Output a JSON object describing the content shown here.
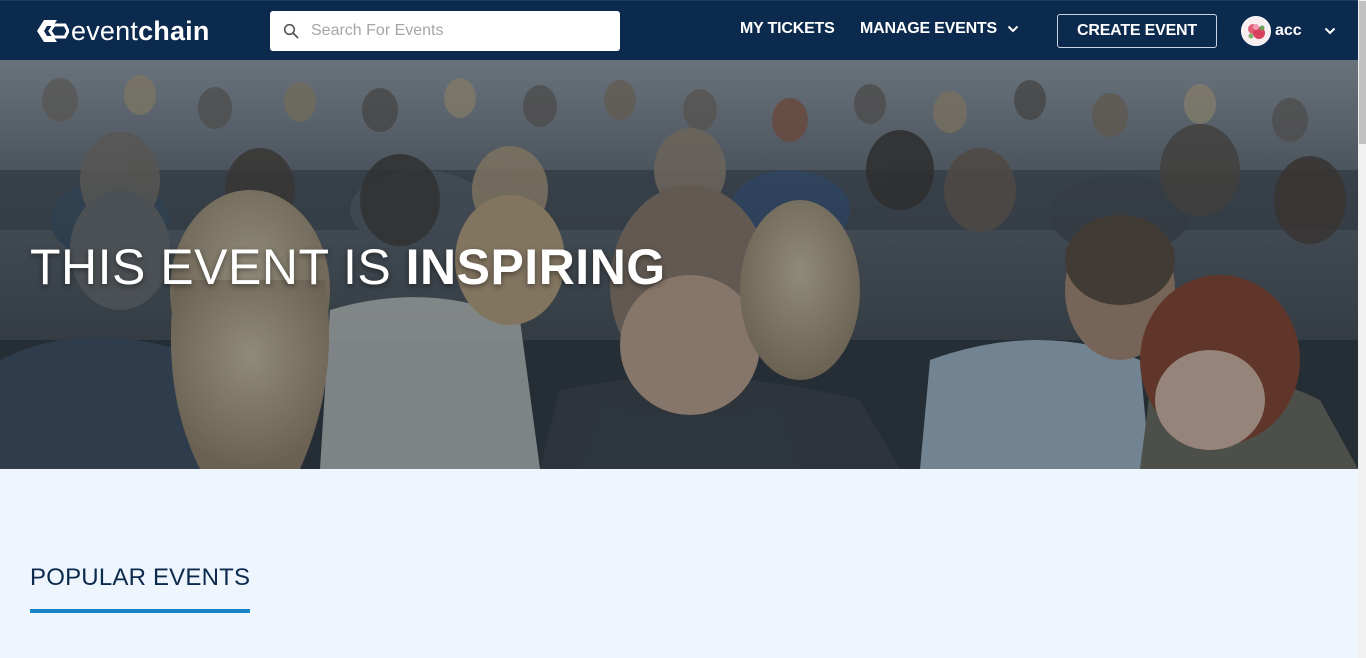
{
  "brand": {
    "name_light": "event",
    "name_bold": "chain"
  },
  "search": {
    "placeholder": "Search For Events",
    "value": ""
  },
  "nav": {
    "my_tickets": "MY TICKETS",
    "manage_events": "MANAGE EVENTS",
    "create_event": "CREATE EVENT",
    "username": "acc"
  },
  "hero": {
    "title_regular": "THIS EVENT IS ",
    "title_bold": "INSPIRING"
  },
  "sections": {
    "popular_title": "POPULAR EVENTS"
  },
  "colors": {
    "navbar": "#0c2a4d",
    "page_background": "#eef5fd",
    "accent": "#1a84c7",
    "heading": "#0c2a4d"
  },
  "icons": {
    "logo": "eventchain-logo-icon",
    "search": "search-icon",
    "dropdown": "chevron-down-icon",
    "avatar": "avatar-icon"
  }
}
